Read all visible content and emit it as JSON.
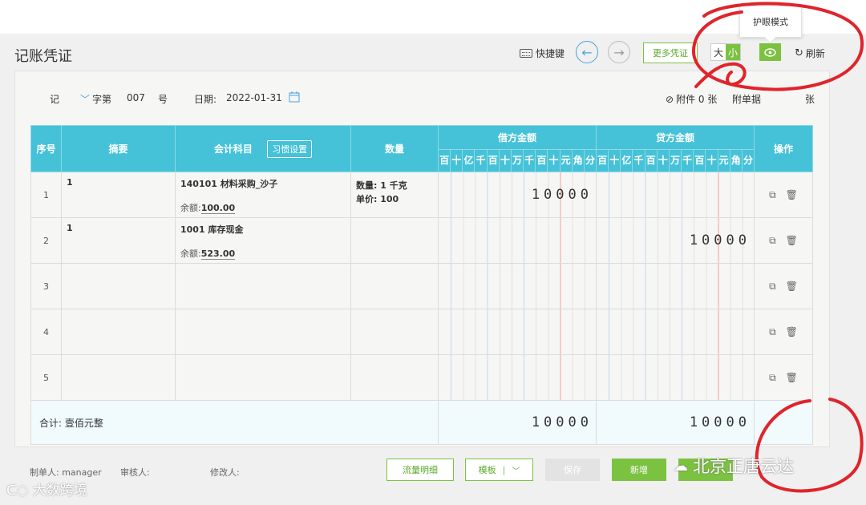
{
  "tooltip": "护眼模式",
  "page_title": "记账凭证",
  "toolbar": {
    "shortcut_label": "快捷键",
    "prev_icon": "arrow-left-icon",
    "next_icon": "arrow-right-icon",
    "more_vouchers": "更多凭证",
    "size_large": "大",
    "size_small": "小",
    "refresh": "刷新"
  },
  "voucher_header": {
    "word": "记",
    "word_suffix": "字第",
    "number": "007",
    "number_suffix": "号",
    "date_label": "日期:",
    "date_value": "2022-01-31",
    "attachment": "附件 0 张",
    "attached_docs": "附单据",
    "sheets": "张"
  },
  "table": {
    "headers": {
      "index": "序号",
      "summary": "摘要",
      "account": "会计科目",
      "habit_button": "习惯设置",
      "quantity": "数量",
      "debit": "借方金额",
      "credit": "贷方金额",
      "action": "操作"
    },
    "digit_units": [
      "百",
      "十",
      "亿",
      "千",
      "百",
      "十",
      "万",
      "千",
      "百",
      "十",
      "元",
      "角",
      "分"
    ],
    "rows": [
      {
        "index": "1",
        "summary": "1",
        "account": "140101 材料采购_沙子",
        "balance_label": "余额:",
        "balance": "100.00",
        "qty_line": "数量: 1 千克",
        "price_line": "单价: 100",
        "debit": "10000",
        "credit": ""
      },
      {
        "index": "2",
        "summary": "1",
        "account": "1001 库存现金",
        "balance_label": "余额:",
        "balance": "523.00",
        "qty_line": "",
        "price_line": "",
        "debit": "",
        "credit": "10000"
      },
      {
        "index": "3",
        "summary": "",
        "account": "",
        "balance_label": "",
        "balance": "",
        "qty_line": "",
        "price_line": "",
        "debit": "",
        "credit": ""
      },
      {
        "index": "4",
        "summary": "",
        "account": "",
        "balance_label": "",
        "balance": "",
        "qty_line": "",
        "price_line": "",
        "debit": "",
        "credit": ""
      },
      {
        "index": "5",
        "summary": "",
        "account": "",
        "balance_label": "",
        "balance": "",
        "qty_line": "",
        "price_line": "",
        "debit": "",
        "credit": ""
      }
    ],
    "total_label": "合计: 壹佰元整",
    "total_debit": "10000",
    "total_credit": "10000"
  },
  "footer": {
    "maker": "制单人: manager",
    "reviewer": "审核人:",
    "modifier": "修改人:",
    "flow_detail": "流量明细",
    "template": "模板",
    "save": "保存",
    "add_new": "新增"
  },
  "watermarks": {
    "left": "大数跨境",
    "right": "北京正唐云达"
  },
  "colors": {
    "accent_green": "#7cc241",
    "table_header": "#45c2d7",
    "annotation_red": "#e0242b"
  }
}
